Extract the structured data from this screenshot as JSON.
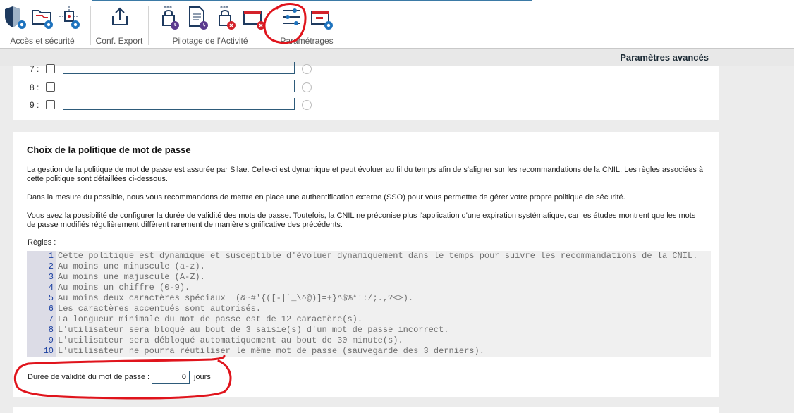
{
  "ribbon": {
    "groups": [
      {
        "label": "Accès et sécurité",
        "icons": [
          "shield-gear-icon",
          "folder-gear-icon",
          "network-gear-icon"
        ]
      },
      {
        "label": "Conf. Export",
        "icons": [
          "export-icon"
        ]
      },
      {
        "label": "Pilotage de l'Activité",
        "icons": [
          "lock-clock-icon",
          "document-clock-icon",
          "lock-error-icon",
          "window-error-icon"
        ]
      },
      {
        "label": "Paramétrages",
        "icons": [
          "sliders-icon",
          "window-gear-icon"
        ]
      }
    ]
  },
  "advanced_bar": {
    "title": "Paramètres avancés"
  },
  "rows": [
    {
      "num": "7 :"
    },
    {
      "num": "8 :"
    },
    {
      "num": "9 :"
    }
  ],
  "policy": {
    "title": "Choix de la politique de mot de passe",
    "para1": "La gestion de la politique de mot de passe est assurée par Silae. Celle-ci est dynamique et peut évoluer au fil du temps afin de s'aligner sur les recommandations de la CNIL. Les règles associées à cette politique sont détaillées ci-dessous.",
    "para2": "Dans la mesure du possible, nous vous recommandons de mettre en place une authentification externe (SSO) pour vous permettre de gérer votre propre politique de sécurité.",
    "para3": "Vous avez la possibilité de configurer la durée de validité des mots de passe. Toutefois, la CNIL ne préconise plus l'application d'une expiration systématique, car les études montrent que les mots de passe modifiés régulièrement diffèrent rarement de manière significative des précédents.",
    "rules_label": "Règles :",
    "rules": [
      {
        "n": "1",
        "text": "Cette politique est dynamique et susceptible d'évoluer dynamiquement dans le temps pour suivre les recommandations de la CNIL."
      },
      {
        "n": "2",
        "text": "Au moins une minuscule (a-z)."
      },
      {
        "n": "3",
        "text": "Au moins une majuscule (A-Z)."
      },
      {
        "n": "4",
        "text": "Au moins un chiffre (0-9)."
      },
      {
        "n": "5",
        "text": "Au moins deux caractères spéciaux  (&~#'{([-|`_\\^@)]=+}^$%*!:/;.,?<>)."
      },
      {
        "n": "6",
        "text": "Les caractères accentués sont autorisés."
      },
      {
        "n": "7",
        "text": "La longueur minimale du mot de passe est de 12 caractère(s)."
      },
      {
        "n": "8",
        "text": "L'utilisateur sera bloqué au bout de 3 saisie(s) d'un mot de passe incorrect."
      },
      {
        "n": "9",
        "text": "L'utilisateur sera débloqué automatiquement au bout de 30 minute(s)."
      },
      {
        "n": "10",
        "text": "L'utilisateur ne pourra réutiliser le même mot de passe (sauvegarde des 3 derniers)."
      }
    ],
    "duree_label": "Durée de validité du mot de passe :",
    "duree_value": "0",
    "duree_unit": "jours"
  },
  "colors": {
    "accent": "#3b7aa6",
    "annotation": "#e0141c",
    "badge_blue": "#1e73be",
    "badge_red": "#d3222a",
    "badge_purple": "#5b3a8e"
  }
}
